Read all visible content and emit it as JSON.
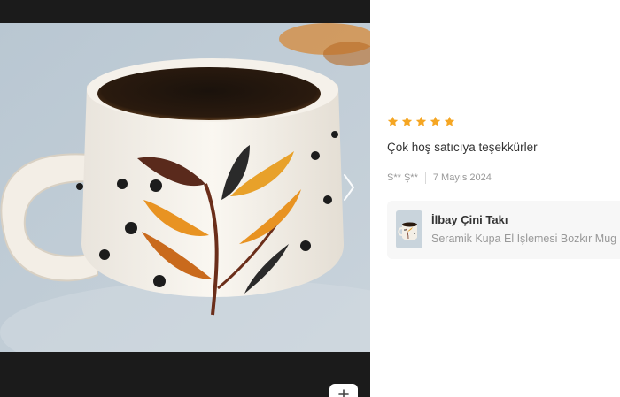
{
  "review": {
    "rating": 5,
    "rating_max": 5,
    "star_color": "#f5a623",
    "text": "Çok hoş satıcıya teşekkürler",
    "reviewer": "S** Ş**",
    "date": "7 Mayıs 2024"
  },
  "product": {
    "seller": "İlbay Çini Takı",
    "title": "Seramik Kupa El İşlemesi Bozkır Mug"
  },
  "icons": {
    "next": "chevron-right-icon",
    "zoom": "plus-icon",
    "star": "star-icon"
  }
}
